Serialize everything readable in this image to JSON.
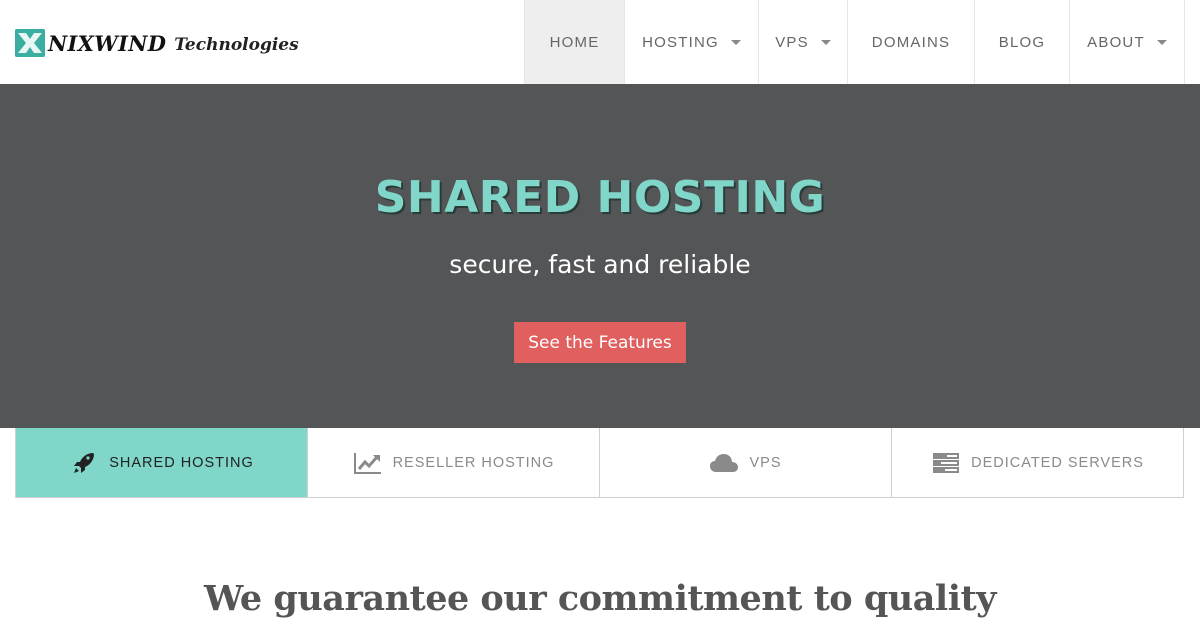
{
  "header": {
    "logo": {
      "icon": "x-logo-icon",
      "name": "NIXWIND",
      "sub": "Technologies"
    },
    "nav": [
      {
        "label": "HOME",
        "active": true,
        "dropdown": false
      },
      {
        "label": "HOSTING",
        "active": false,
        "dropdown": true
      },
      {
        "label": "VPS",
        "active": false,
        "dropdown": true
      },
      {
        "label": "DOMAINS",
        "active": false,
        "dropdown": false
      },
      {
        "label": "BLOG",
        "active": false,
        "dropdown": false
      },
      {
        "label": "ABOUT",
        "active": false,
        "dropdown": true
      }
    ]
  },
  "hero": {
    "title": "SHARED HOSTING",
    "subtitle": "secure, fast and reliable",
    "button_label": "See the Features"
  },
  "tabs": [
    {
      "label": "SHARED HOSTING",
      "icon": "rocket-icon",
      "active": true
    },
    {
      "label": "RESELLER HOSTING",
      "icon": "line-chart-icon",
      "active": false
    },
    {
      "label": "VPS",
      "icon": "cloud-icon",
      "active": false
    },
    {
      "label": "DEDICATED SERVERS",
      "icon": "server-icon",
      "active": false
    }
  ],
  "section": {
    "title": "We guarantee our commitment to quality"
  },
  "colors": {
    "accent": "#7fd6c9",
    "hero_bg": "#545557",
    "button": "#e05f5f",
    "nav_active_bg": "#eeeeee"
  }
}
